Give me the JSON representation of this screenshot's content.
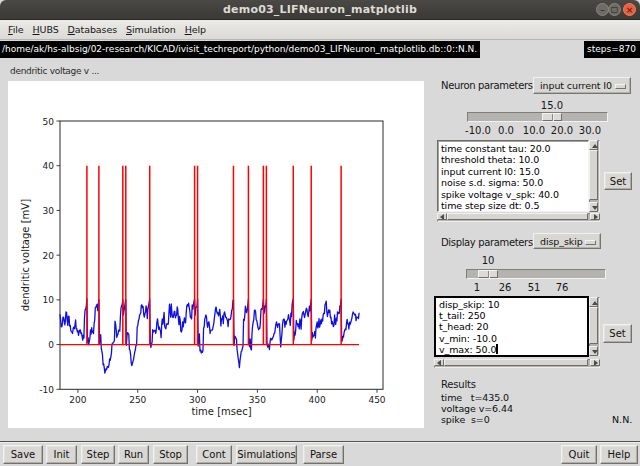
{
  "titlebar": {
    "title": "demo03_LIFNeuron_matplotlib",
    "minimize_icon": "–",
    "maximize_icon": "▢",
    "close_icon": "×"
  },
  "menubar": {
    "items": [
      {
        "label": "File",
        "underline": 0
      },
      {
        "label": "HUBS",
        "underline": 0
      },
      {
        "label": "Databases",
        "underline": 0
      },
      {
        "label": "Simulation",
        "underline": 0
      },
      {
        "label": "Help",
        "underline": 0
      }
    ]
  },
  "statusbar": {
    "path": "/home/ak/hs-albsig/02-research/KICAD/ivisit_techreport/python/demo03_LIFNeuron_matplotlib.db::0::N.N.",
    "steps": "steps=870"
  },
  "plot_panel": {
    "label": "dendritic voltage v ..."
  },
  "chart_data": {
    "type": "line",
    "xlabel": "time [msec]",
    "ylabel": "dendritic voltage [mV]",
    "xlim": [
      185,
      455
    ],
    "ylim": [
      -10,
      50
    ],
    "xticks": [
      200,
      250,
      300,
      350,
      400,
      450
    ],
    "yticks": [
      -10,
      0,
      10,
      20,
      30,
      40,
      50
    ],
    "grid": false,
    "baseline": {
      "y": 0,
      "x_span": [
        185,
        435
      ],
      "color": "#ff0000"
    },
    "spikes": {
      "times": [
        207.5,
        217.5,
        237.5,
        240.0,
        260.0,
        297.5,
        300.0,
        330.0,
        342.5,
        355.0,
        357.5,
        380.0,
        395.0,
        420.0
      ],
      "ymin": 0,
      "ymax": 40,
      "color": "#ff0000"
    },
    "series": [
      {
        "name": "dendritic voltage v",
        "color": "#0f0fe0",
        "x": [
          185.0,
          185.5,
          186.0,
          186.5,
          187.0,
          187.5,
          188.0,
          188.5,
          189.0,
          189.5,
          190.0,
          190.5,
          191.0,
          191.5,
          192.0,
          192.5,
          193.0,
          193.5,
          194.0,
          194.5,
          195.0,
          195.5,
          196.0,
          196.5,
          197.0,
          197.5,
          198.0,
          198.5,
          199.0,
          199.5,
          200.0,
          200.5,
          201.0,
          201.5,
          202.0,
          202.5,
          203.0,
          203.5,
          204.0,
          204.5,
          205.0,
          205.5,
          206.0,
          206.5,
          207.0,
          207.5,
          208.0,
          208.5,
          209.0,
          209.5,
          210.0,
          210.5,
          211.0,
          211.5,
          212.0,
          212.5,
          213.0,
          213.5,
          214.0,
          214.5,
          215.0,
          215.5,
          216.0,
          216.5,
          217.0,
          217.5,
          218.0,
          218.5,
          219.0,
          219.5,
          220.0,
          220.5,
          221.0,
          221.5,
          222.0,
          222.5,
          223.0,
          223.5,
          224.0,
          224.5,
          225.0,
          225.5,
          226.0,
          226.5,
          227.0,
          227.5,
          228.0,
          228.5,
          229.0,
          229.5,
          230.0,
          230.5,
          231.0,
          231.5,
          232.0,
          232.5,
          233.0,
          233.5,
          234.0,
          234.5,
          235.0,
          235.5,
          236.0,
          236.5,
          237.0,
          237.5,
          238.0,
          238.5,
          239.0,
          239.5,
          240.0,
          240.5,
          241.0,
          241.5,
          242.0,
          242.5,
          243.0,
          243.5,
          244.0,
          244.5,
          245.0,
          245.5,
          246.0,
          246.5,
          247.0,
          247.5,
          248.0,
          248.5,
          249.0,
          249.5,
          250.0,
          250.5,
          251.0,
          251.5,
          252.0,
          252.5,
          253.0,
          253.5,
          254.0,
          254.5,
          255.0,
          255.5,
          256.0,
          256.5,
          257.0,
          257.5,
          258.0,
          258.5,
          259.0,
          259.5,
          260.0,
          260.5,
          261.0,
          261.5,
          262.0,
          262.5,
          263.0,
          263.5,
          264.0,
          264.5,
          265.0,
          265.5,
          266.0,
          266.5,
          267.0,
          267.5,
          268.0,
          268.5,
          269.0,
          269.5,
          270.0,
          270.5,
          271.0,
          271.5,
          272.0,
          272.5,
          273.0,
          273.5,
          274.0,
          274.5,
          275.0,
          275.5,
          276.0,
          276.5,
          277.0,
          277.5,
          278.0,
          278.5,
          279.0,
          279.5,
          280.0,
          280.5,
          281.0,
          281.5,
          282.0,
          282.5,
          283.0,
          283.5,
          284.0,
          284.5,
          285.0,
          285.5,
          286.0,
          286.5,
          287.0,
          287.5,
          288.0,
          288.5,
          289.0,
          289.5,
          290.0,
          290.5,
          291.0,
          291.5,
          292.0,
          292.5,
          293.0,
          293.5,
          294.0,
          294.5,
          295.0,
          295.5,
          296.0,
          296.5,
          297.0,
          297.5,
          298.0,
          298.5,
          299.0,
          299.5,
          300.0,
          300.5,
          301.0,
          301.5,
          302.0,
          302.5,
          303.0,
          303.5,
          304.0,
          304.5,
          305.0,
          305.5,
          306.0,
          306.5,
          307.0,
          307.5,
          308.0,
          308.5,
          309.0,
          309.5,
          310.0,
          310.5,
          311.0,
          311.5,
          312.0,
          312.5,
          313.0,
          313.5,
          314.0,
          314.5,
          315.0,
          315.5,
          316.0,
          316.5,
          317.0,
          317.5,
          318.0,
          318.5,
          319.0,
          319.5,
          320.0,
          320.5,
          321.0,
          321.5,
          322.0,
          322.5,
          323.0,
          323.5,
          324.0,
          324.5,
          325.0,
          325.5,
          326.0,
          326.5,
          327.0,
          327.5,
          328.0,
          328.5,
          329.0,
          329.5,
          330.0,
          330.5,
          331.0,
          331.5,
          332.0,
          332.5,
          333.0,
          333.5,
          334.0,
          334.5,
          335.0,
          335.5,
          336.0,
          336.5,
          337.0,
          337.5,
          338.0,
          338.5,
          339.0,
          339.5,
          340.0,
          340.5,
          341.0,
          341.5,
          342.0,
          342.5,
          343.0,
          343.5,
          344.0,
          344.5,
          345.0,
          345.5,
          346.0,
          346.5,
          347.0,
          347.5,
          348.0,
          348.5,
          349.0,
          349.5,
          350.0,
          350.5,
          351.0,
          351.5,
          352.0,
          352.5,
          353.0,
          353.5,
          354.0,
          354.5,
          355.0,
          355.5,
          356.0,
          356.5,
          357.0,
          357.5,
          358.0,
          358.5,
          359.0,
          359.5,
          360.0,
          360.5,
          361.0,
          361.5,
          362.0,
          362.5,
          363.0,
          363.5,
          364.0,
          364.5,
          365.0,
          365.5,
          366.0,
          366.5,
          367.0,
          367.5,
          368.0,
          368.5,
          369.0,
          369.5,
          370.0,
          370.5,
          371.0,
          371.5,
          372.0,
          372.5,
          373.0,
          373.5,
          374.0,
          374.5,
          375.0,
          375.5,
          376.0,
          376.5,
          377.0,
          377.5,
          378.0,
          378.5,
          379.0,
          379.5,
          380.0,
          380.5,
          381.0,
          381.5,
          382.0,
          382.5,
          383.0,
          383.5,
          384.0,
          384.5,
          385.0,
          385.5,
          386.0,
          386.5,
          387.0,
          387.5,
          388.0,
          388.5,
          389.0,
          389.5,
          390.0,
          390.5,
          391.0,
          391.5,
          392.0,
          392.5,
          393.0,
          393.5,
          394.0,
          394.5,
          395.0,
          395.5,
          396.0,
          396.5,
          397.0,
          397.5,
          398.0,
          398.5,
          399.0,
          399.5,
          400.0,
          400.5,
          401.0,
          401.5,
          402.0,
          402.5,
          403.0,
          403.5,
          404.0,
          404.5,
          405.0,
          405.5,
          406.0,
          406.5,
          407.0,
          407.5,
          408.0,
          408.5,
          409.0,
          409.5,
          410.0,
          410.5,
          411.0,
          411.5,
          412.0,
          412.5,
          413.0,
          413.5,
          414.0,
          414.5,
          415.0,
          415.5,
          416.0,
          416.5,
          417.0,
          417.5,
          418.0,
          418.5,
          419.0,
          419.5,
          420.0,
          420.5,
          421.0,
          421.5,
          422.0,
          422.5,
          423.0,
          423.5,
          424.0,
          424.5,
          425.0,
          425.5,
          426.0,
          426.5,
          427.0,
          427.5,
          428.0,
          428.5,
          429.0,
          429.5,
          430.0,
          430.5,
          431.0,
          431.5,
          432.0,
          432.5,
          433.0,
          433.5,
          434.0,
          434.5,
          435.0
        ],
        "y": [
          6.8,
          5.58,
          4.0,
          3.97,
          4.72,
          6.14,
          6.1,
          5.31,
          4.4,
          5.44,
          7.29,
          7.21,
          5.41,
          4.29,
          6.33,
          6.36,
          4.15,
          4.29,
          3.15,
          2.86,
          2.78,
          2.47,
          3.67,
          3.92,
          3.52,
          4.35,
          5.49,
          3.56,
          3.62,
          2.83,
          3.12,
          2.07,
          2.74,
          3.21,
          3.28,
          2.48,
          2.59,
          1.87,
          1.0,
          2.12,
          1.48,
          6.03,
          7.78,
          7.92,
          8.6,
          10.25,
          0.52,
          1.53,
          -0.0,
          0.79,
          1.4,
          3.28,
          2.33,
          3.77,
          2.81,
          2.93,
          2.44,
          4.68,
          5.45,
          8.22,
          8.37,
          8.73,
          9.01,
          7.57,
          9.01,
          10.08,
          0.22,
          1.46,
          2.2,
          -0.84,
          -1.51,
          -2.32,
          -4.52,
          -4.34,
          -5.25,
          -6.37,
          -5.83,
          -5.39,
          -5.58,
          -4.89,
          -5.0,
          -5.11,
          -4.52,
          -3.23,
          -3.55,
          -2.83,
          -2.03,
          0.15,
          0.1,
          0.51,
          0.57,
          0.84,
          5.23,
          4.65,
          3.33,
          1.61,
          2.12,
          2.35,
          3.24,
          3.12,
          3.01,
          6.19,
          8.1,
          8.7,
          8.97,
          10.11,
          6.64,
          7.57,
          8.25,
          9.36,
          10.12,
          -0.16,
          1.98,
          2.66,
          2.48,
          2.32,
          -1.07,
          -1.24,
          -2.2,
          -4.05,
          -4.7,
          -4.28,
          -3.71,
          -3.31,
          -2.34,
          -1.61,
          -1.09,
          -0.09,
          -0.14,
          3.94,
          4.28,
          5.31,
          5.65,
          6.58,
          6.85,
          7.11,
          8.84,
          8.85,
          8.29,
          8.51,
          6.81,
          6.12,
          6.87,
          7.28,
          8.66,
          8.0,
          5.78,
          7.92,
          8.66,
          9.31,
          10.27,
          0.52,
          -0.61,
          0.09,
          0.55,
          3.33,
          2.81,
          3.02,
          3.16,
          3.15,
          2.53,
          3.33,
          4.97,
          5.75,
          4.59,
          3.41,
          3.93,
          3.39,
          3.05,
          1.57,
          4.56,
          5.76,
          4.55,
          5.74,
          7.2,
          4.07,
          3.68,
          3.56,
          4.65,
          4.64,
          4.51,
          4.6,
          6.87,
          9.04,
          7.69,
          6.15,
          9.07,
          7.19,
          6.15,
          6.03,
          6.44,
          7.39,
          7.42,
          6.0,
          6.44,
          6.5,
          8.42,
          7.78,
          5.74,
          4.45,
          6.29,
          5.47,
          3.02,
          2.81,
          3.3,
          5.07,
          3.95,
          4.99,
          5.96,
          5.03,
          4.87,
          6.99,
          8.63,
          8.95,
          8.6,
          9.25,
          8.3,
          7.59,
          6.14,
          5.98,
          5.75,
          8.85,
          7.92,
          8.86,
          9.66,
          10.15,
          6.59,
          8.2,
          8.43,
          8.51,
          10.14,
          -0.31,
          2.03,
          2.38,
          -1.41,
          -1.17,
          -1.89,
          -1.49,
          -1.75,
          -1.21,
          3.7,
          3.96,
          5.75,
          6.06,
          6.64,
          6.2,
          4.54,
          3.87,
          4.91,
          5.1,
          4.1,
          2.48,
          3.17,
          3.21,
          3.22,
          3.26,
          3.99,
          4.59,
          5.84,
          6.8,
          8.03,
          8.41,
          7.4,
          6.92,
          7.17,
          6.44,
          6.84,
          7.86,
          6.43,
          4.16,
          5.76,
          5.69,
          6.43,
          4.67,
          6.79,
          7.34,
          6.79,
          6.09,
          6.06,
          5.72,
          5.31,
          4.02,
          5.73,
          5.6,
          5.62,
          5.67,
          6.46,
          7.62,
          7.93,
          9.8,
          10.05,
          -0.18,
          1.89,
          1.77,
          1.44,
          1.22,
          -1.22,
          -2.12,
          -3.11,
          -3.91,
          -5.16,
          -3.59,
          -2.57,
          -1.58,
          -1.45,
          -0.81,
          -0.42,
          5.67,
          5.37,
          6.44,
          8.61,
          7.71,
          7.17,
          7.74,
          8.75,
          10.14,
          -0.01,
          -0.47,
          1.29,
          -0.91,
          -1.18,
          2.43,
          4.2,
          5.02,
          5.6,
          7.58,
          7.74,
          7.34,
          5.52,
          5.39,
          4.53,
          3.87,
          3.33,
          3.68,
          3.62,
          4.96,
          7.86,
          8.02,
          7.89,
          8.98,
          10.13,
          6.96,
          7.61,
          8.71,
          8.38,
          10.18,
          0.23,
          -0.53,
          0.1,
          -0.3,
          -1.09,
          0.43,
          1.35,
          1.35,
          1.05,
          1.28,
          1.63,
          1.89,
          2.51,
          2.57,
          3.56,
          4.51,
          5.08,
          4.36,
          3.84,
          4.63,
          4.54,
          4.64,
          1.91,
          -0.52,
          1.03,
          2.26,
          4.47,
          5.47,
          5.69,
          5.63,
          3.92,
          5.21,
          4.54,
          5.27,
          5.5,
          5.78,
          6.71,
          5.86,
          5.3,
          4.32,
          7.03,
          6.24,
          8.9,
          9.8,
          10.29,
          1.01,
          2.79,
          2.13,
          3.19,
          5.44,
          4.61,
          4.7,
          4.02,
          4.64,
          3.53,
          5.74,
          5.22,
          3.46,
          5.89,
          6.89,
          7.17,
          7.4,
          6.57,
          6.06,
          6.74,
          7.51,
          8.14,
          7.82,
          6.78,
          6.26,
          7.34,
          8.59,
          7.54,
          9.07,
          10.1,
          1.01,
          2.67,
          1.68,
          1.98,
          2.05,
          2.94,
          1.47,
          3.7,
          4.37,
          5.05,
          3.74,
          4.02,
          5.81,
          3.9,
          4.54,
          5.49,
          4.66,
          5.72,
          5.26,
          6.68,
          7.01,
          6.93,
          8.91,
          9.15,
          9.7,
          7.45,
          6.28,
          7.04,
          7.74,
          7.19,
          7.71,
          6.01,
          6.11,
          4.63,
          5.16,
          4.63,
          4.02,
          4.34,
          6.62,
          5.2,
          4.52,
          5.91,
          5.3,
          7.33,
          7.18,
          6.91,
          7.0,
          8.66,
          8.74,
          10.18,
          0.68,
          0.96,
          1.85,
          1.67,
          2.71,
          3.19,
          3.5,
          3.33,
          4.7,
          5.63,
          4.63,
          4.64,
          3.49,
          5.01,
          4.49,
          4.94,
          5.44,
          5.92,
          6.75,
          7.28,
          7.01,
          6.79,
          6.55,
          6.79,
          5.35,
          6.2,
          6.06,
          6.07,
          5.8,
          7.13
        ]
      }
    ]
  },
  "neuron": {
    "section_label": "Neuron parameters",
    "option_selected": "input current I0",
    "slider": {
      "value_label": "15.0",
      "value": 15,
      "min": -10,
      "max": 30,
      "ticks": [
        "-10.0",
        "0.0",
        "10.0",
        "20.0",
        "30.0"
      ]
    },
    "list_items": [
      "time constant tau: 20.0",
      "threshold theta: 10.0",
      "input current I0: 15.0",
      "noise s.d. sigma: 50.0",
      "spike voltage v_spk: 40.0",
      "time step size dt: 0.5"
    ],
    "set_label": "Set"
  },
  "display": {
    "section_label": "Display parameters",
    "option_selected": "disp_skip",
    "slider": {
      "value_label": "10",
      "value": 10,
      "min": 1,
      "max": 100,
      "ticks": [
        "1",
        "26",
        "51",
        "76"
      ]
    },
    "text_lines": [
      "disp_skip: 10",
      "t_tail: 250",
      "t_head: 20",
      "v_min: -10.0",
      "v_max: 50.0"
    ],
    "set_label": "Set"
  },
  "results": {
    "header": "Results",
    "lines": [
      "time   t=435.0",
      "voltage v=6.44",
      "spike  s=0"
    ],
    "signature": "N.N."
  },
  "toolbar": {
    "left": [
      "Save",
      "Init",
      "Step",
      "Run",
      "Stop",
      "Cont",
      "Simulations",
      "Parse"
    ],
    "right": [
      "Quit",
      "Help"
    ]
  },
  "colors": {
    "titlebar_bg": "#3c3b37",
    "close_button": "#e8603f",
    "spike_red": "#ff0000",
    "trace_blue": "#0f0fe0",
    "panel_bg": "#d9d9d9"
  }
}
